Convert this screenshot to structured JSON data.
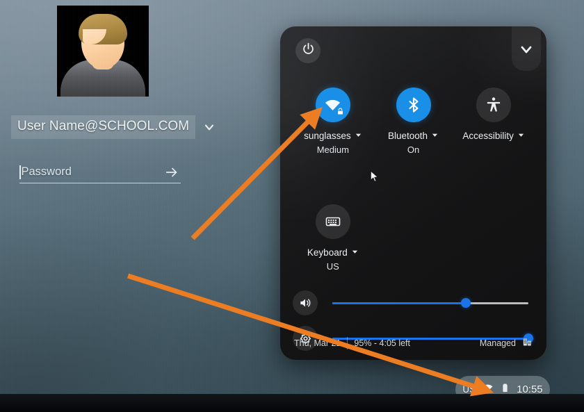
{
  "login": {
    "avatar_alt": "user-avatar-illustration",
    "user_name": "User Name@SCHOOL.COM",
    "user_dropdown_icon": "chevron-down-icon",
    "password_placeholder": "Password",
    "password_value": "",
    "password_submit_icon": "arrow-right-icon"
  },
  "quick_settings": {
    "power_icon": "power-icon",
    "collapse_icon": "chevron-down-icon",
    "tiles": [
      {
        "name": "network",
        "icon": "wifi-locked-icon",
        "label": "sunglasses",
        "sub": "Medium",
        "state": "on",
        "dropdown_icon": "chevron-down-icon"
      },
      {
        "name": "bluetooth",
        "icon": "bluetooth-icon",
        "label": "Bluetooth",
        "sub": "On",
        "state": "on",
        "dropdown_icon": "chevron-down-icon"
      },
      {
        "name": "accessibility",
        "icon": "accessibility-icon",
        "label": "Accessibility",
        "sub": "",
        "state": "off",
        "dropdown_icon": "chevron-down-icon"
      },
      {
        "name": "keyboard",
        "icon": "keyboard-icon",
        "label": "Keyboard",
        "sub": "US",
        "state": "off",
        "dropdown_icon": "chevron-down-icon"
      }
    ],
    "sliders": [
      {
        "name": "volume",
        "icon": "volume-icon",
        "percent": 68
      },
      {
        "name": "brightness",
        "icon": "brightness-icon",
        "percent": 100
      }
    ],
    "footer": {
      "date": "Thu, Mar 21",
      "battery": "95% - 4:05 left",
      "managed_label": "Managed",
      "managed_icon": "enterprise-building-icon"
    }
  },
  "system_tray": {
    "locale": "US",
    "wifi_icon": "wifi-icon",
    "battery_icon": "battery-icon",
    "time": "10:55"
  },
  "annotations": [
    {
      "name": "arrow-to-wifi-tile",
      "color": "#ED7D23"
    },
    {
      "name": "arrow-to-tray-wifi",
      "color": "#ED7D23"
    }
  ],
  "colors": {
    "accent_blue": "#1a73e8",
    "tile_on_blue": "#1a8fe8",
    "annotation_orange": "#ED7D23",
    "panel_bg": "#17181a"
  }
}
